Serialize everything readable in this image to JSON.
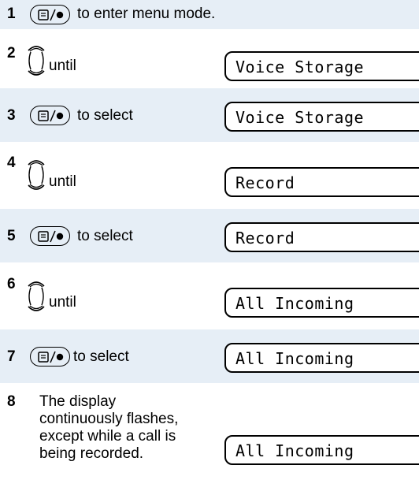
{
  "steps": [
    {
      "num": "1",
      "text": "to enter menu mode."
    },
    {
      "num": "2",
      "text": "until",
      "display": "Voice Storage"
    },
    {
      "num": "3",
      "text": "to select",
      "display": "Voice Storage"
    },
    {
      "num": "4",
      "text": "until",
      "display": "Record"
    },
    {
      "num": "5",
      "text": "to select",
      "display": "Record"
    },
    {
      "num": "6",
      "text": "until",
      "display": "All Incoming"
    },
    {
      "num": "7",
      "text": "to select",
      "display": "All Incoming"
    },
    {
      "num": "8",
      "text": "The display continuously flashes, except while a call is being recorded.",
      "display": "All Incoming"
    }
  ],
  "icons": {
    "menu_key": "menu-select-key-icon",
    "nav_key": "navigation-scroll-key-icon"
  },
  "colors": {
    "band": "#e6eef6",
    "text": "#000000"
  }
}
